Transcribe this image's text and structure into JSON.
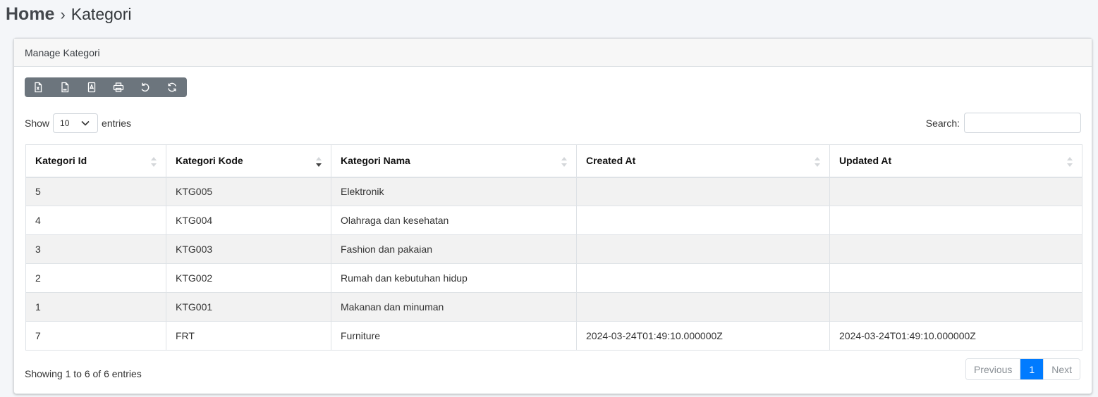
{
  "breadcrumb": {
    "home": "Home",
    "separator": "›",
    "current": "Kategori"
  },
  "card": {
    "title": "Manage Kategori"
  },
  "toolbar": [
    {
      "name": "export-excel-button",
      "icon": "file-excel-icon"
    },
    {
      "name": "export-csv-button",
      "icon": "file-csv-icon"
    },
    {
      "name": "export-pdf-button",
      "icon": "file-pdf-icon"
    },
    {
      "name": "print-button",
      "icon": "printer-icon"
    },
    {
      "name": "reset-button",
      "icon": "rotate-ccw-icon"
    },
    {
      "name": "reload-button",
      "icon": "refresh-icon"
    }
  ],
  "length": {
    "show_label": "Show",
    "selected": "10",
    "entries_label": "entries"
  },
  "search": {
    "label": "Search:",
    "value": ""
  },
  "table": {
    "columns": [
      "Kategori Id",
      "Kategori Kode",
      "Kategori Nama",
      "Created At",
      "Updated At"
    ],
    "sorted_column": "Kategori Kode",
    "sort_direction": "descending",
    "rows": [
      [
        "5",
        "KTG005",
        "Elektronik",
        "",
        ""
      ],
      [
        "4",
        "KTG004",
        "Olahraga dan kesehatan",
        "",
        ""
      ],
      [
        "3",
        "KTG003",
        "Fashion dan pakaian",
        "",
        ""
      ],
      [
        "2",
        "KTG002",
        "Rumah dan kebutuhan hidup",
        "",
        ""
      ],
      [
        "1",
        "KTG001",
        "Makanan dan minuman",
        "",
        ""
      ],
      [
        "7",
        "FRT",
        "Furniture",
        "2024-03-24T01:49:10.000000Z",
        "2024-03-24T01:49:10.000000Z"
      ]
    ]
  },
  "info": "Showing 1 to 6 of 6 entries",
  "pagination": {
    "previous": "Previous",
    "current": "1",
    "next": "Next"
  },
  "colors": {
    "accent": "#007bff",
    "toolbar": "#6c757d",
    "stripe": "#f2f2f2"
  }
}
